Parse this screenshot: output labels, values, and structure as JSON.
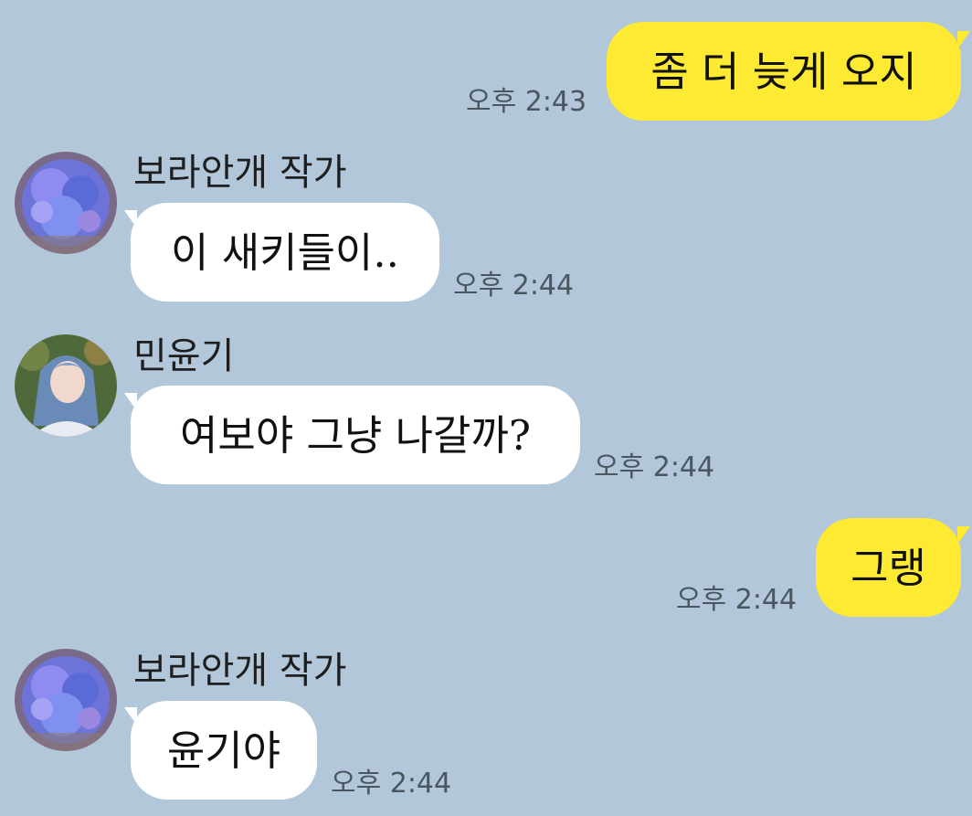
{
  "messages": [
    {
      "direction": "outgoing",
      "text": "좀 더 늦게 오지",
      "time": "오후 2:43"
    },
    {
      "direction": "incoming",
      "sender": "보라안개 작가",
      "avatar": "flower-bouquet-avatar",
      "text": "이 새키들이..",
      "time": "오후 2:44"
    },
    {
      "direction": "incoming",
      "sender": "민윤기",
      "avatar": "blue-hair-person-avatar",
      "text": "여보야 그냥 나갈까?",
      "time": "오후 2:44"
    },
    {
      "direction": "outgoing",
      "text": "그랭",
      "time": "오후 2:44"
    },
    {
      "direction": "incoming",
      "sender": "보라안개 작가",
      "avatar": "flower-bouquet-avatar",
      "text": "윤기야",
      "time": "오후 2:44"
    }
  ],
  "colors": {
    "background": "#b2c7d9",
    "outgoing_bubble": "#fee933",
    "incoming_bubble": "#ffffff",
    "timestamp": "#4a5660"
  }
}
